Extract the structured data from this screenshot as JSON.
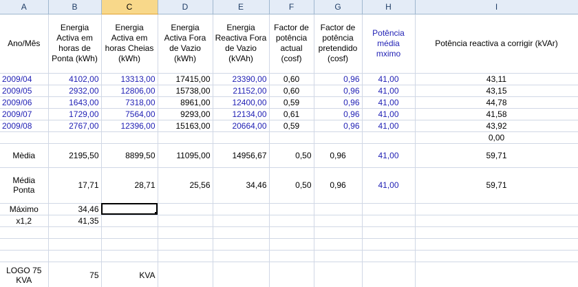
{
  "columns": [
    "A",
    "B",
    "C",
    "D",
    "E",
    "F",
    "G",
    "H",
    "I"
  ],
  "selected_column": "C",
  "headers": [
    "Ano/Mês",
    "Energia Activa em horas de Ponta (kWh)",
    "Energia Activa em horas Cheias (kWh)",
    "Energia Activa Fora de Vazio (kWh)",
    "Energia Reactiva Fora de Vazio (kVAh)",
    "Factor de potência actual (cosf)",
    "Factor de potência pretendido (cosf)",
    "Potência média mximo",
    "Potência reactiva a corrigir (kVAr)"
  ],
  "monthly_rows": [
    [
      "2009/04",
      "4102,00",
      "13313,00",
      "17415,00",
      "23390,00",
      "0,60",
      "0,96",
      "41,00",
      "43,11"
    ],
    [
      "2009/05",
      "2932,00",
      "12806,00",
      "15738,00",
      "21152,00",
      "0,60",
      "0,96",
      "41,00",
      "43,15"
    ],
    [
      "2009/06",
      "1643,00",
      "7318,00",
      "8961,00",
      "12400,00",
      "0,59",
      "0,96",
      "41,00",
      "44,78"
    ],
    [
      "2009/07",
      "1729,00",
      "7564,00",
      "9293,00",
      "12134,00",
      "0,61",
      "0,96",
      "41,00",
      "41,58"
    ],
    [
      "2009/08",
      "2767,00",
      "12396,00",
      "15163,00",
      "20664,00",
      "0,59",
      "0,96",
      "41,00",
      "43,92"
    ]
  ],
  "extra_value": "0,00",
  "media_row": [
    "Mèdia",
    "2195,50",
    "8899,50",
    "11095,00",
    "14956,67",
    "0,50",
    "0,96",
    "41,00",
    "59,71"
  ],
  "media_ponta_row": [
    "Média Ponta",
    "17,71",
    "28,71",
    "25,56",
    "34,46",
    "0,50",
    "0,96",
    "41,00",
    "59,71"
  ],
  "maximo": {
    "label": "Máximo",
    "value": "34,46"
  },
  "x12": {
    "label": "x1,2",
    "value": "41,35"
  },
  "logo": {
    "label": "LOGO 75 KVA",
    "value": "75",
    "unit": "KVA"
  },
  "colors": {
    "blue_text": "#1e1eb4",
    "header_bg": "#e4ecf7",
    "selected_header": "#f8d88a",
    "gridline": "#d0d7e5"
  }
}
